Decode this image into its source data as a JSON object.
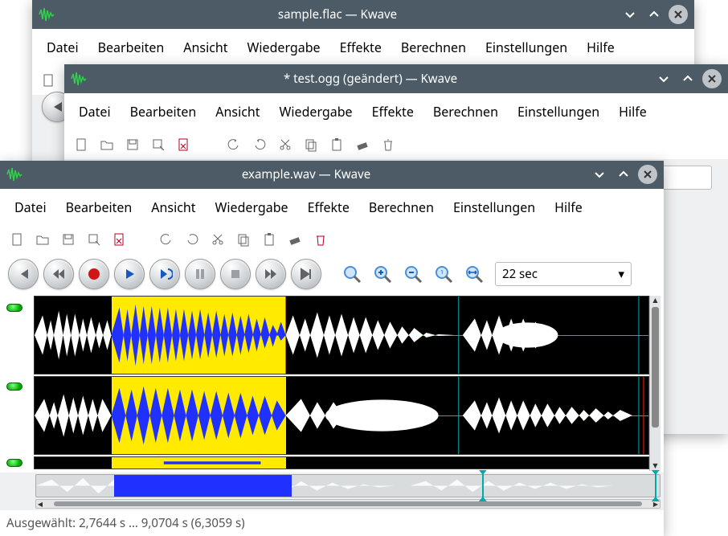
{
  "app_name": "Kwave",
  "menus": [
    "Datei",
    "Bearbeiten",
    "Ansicht",
    "Wiedergabe",
    "Effekte",
    "Berechnen",
    "Einstellungen",
    "Hilfe"
  ],
  "zoom_value": "22 sec",
  "windows": {
    "back": {
      "title": "sample.flac — Kwave"
    },
    "mid": {
      "title": "* test.ogg (geändert) — Kwave"
    },
    "front": {
      "title": "example.wav — Kwave"
    }
  },
  "status": "Ausgewählt: 2,7644 s … 9,0704 s (6,3059 s)",
  "selection": {
    "start_s": 2.7644,
    "end_s": 9.0704,
    "length_s": 6.3059
  },
  "tracks": 3
}
